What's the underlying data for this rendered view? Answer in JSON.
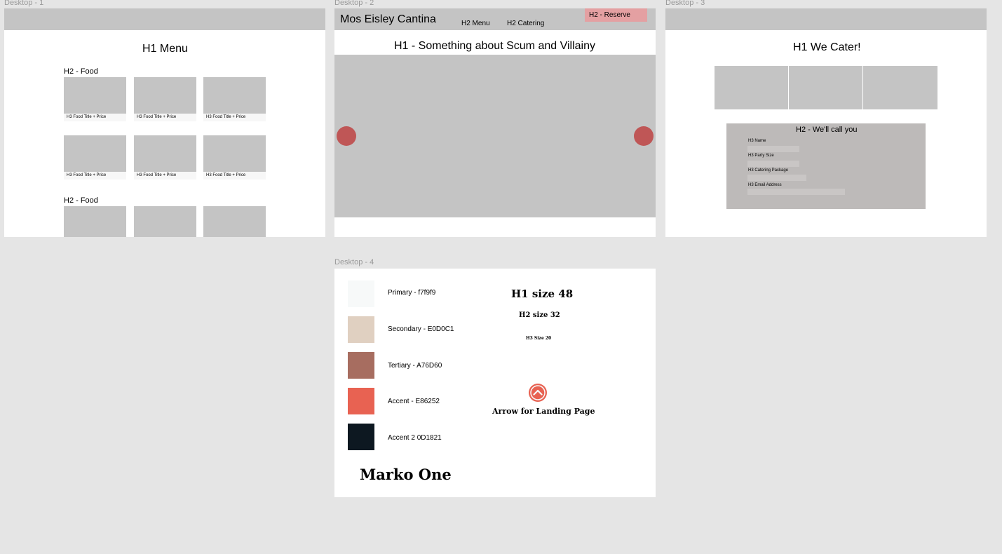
{
  "frames": {
    "desktop1": {
      "label": "Desktop - 1",
      "title": "H1 Menu",
      "sections": [
        {
          "heading": "H2 - Food",
          "card_caption": "H3 Food Title + Price"
        },
        {
          "heading": "H2 - Food"
        }
      ]
    },
    "desktop2": {
      "label": "Desktop - 2",
      "brand": "Mos Eisley Cantina",
      "nav": [
        "H2 Menu",
        "H2 Catering"
      ],
      "reserve_label": "H2 - Reserve",
      "hero_title": "H1 - Something about Scum and Villainy"
    },
    "desktop3": {
      "label": "Desktop - 3",
      "title": "H1 We Cater!",
      "form": {
        "heading": "H2 - We'll call you",
        "fields": [
          "H3 Name",
          "H3 Party Size",
          "H3 Catering Package",
          "H3 Email Address"
        ]
      }
    },
    "desktop4": {
      "label": "Desktop - 4",
      "palette": [
        {
          "label": "Primary - f7f9f9",
          "color": "#f7f9f9"
        },
        {
          "label": "Secondary - E0D0C1",
          "color": "#E0D0C1"
        },
        {
          "label": "Tertiary - A76D60",
          "color": "#A76D60"
        },
        {
          "label": "Accent - E86252",
          "color": "#E86252"
        },
        {
          "label": "Accent 2 0D1821",
          "color": "#0D1821"
        }
      ],
      "type_samples": {
        "h1": "H1 size 48",
        "h2": "H2 size 32",
        "h3": "H3 Size 20"
      },
      "arrow_caption": "Arrow for Landing Page",
      "font_name": "Marko One"
    }
  },
  "icons": {
    "arrow": "chevron-up-circle-icon"
  }
}
